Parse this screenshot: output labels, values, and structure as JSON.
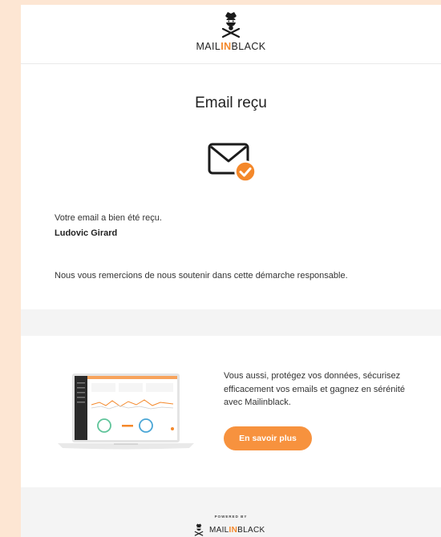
{
  "brand": {
    "name_part1": "MAIL",
    "name_highlight": "IN",
    "name_part2": "BLACK",
    "accent_color": "#f4882a",
    "logo_icon": "masked-pirate-icon"
  },
  "confirmation": {
    "title": "Email reçu",
    "icon": "envelope-check-icon",
    "received_text": "Votre email a bien été reçu.",
    "sender_name": "Ludovic Girard",
    "thanks_text": "Nous vous remercions de nous soutenir dans cette démarche responsable."
  },
  "promo": {
    "image": "laptop-dashboard-image",
    "text": "Vous aussi, protégez vos données, sécurisez efficacement vos emails et gagnez en sérénité avec Mailinblack.",
    "cta_label": "En savoir plus",
    "cta_color": "#f7923e"
  },
  "footer": {
    "powered_by": "POWERED BY"
  }
}
